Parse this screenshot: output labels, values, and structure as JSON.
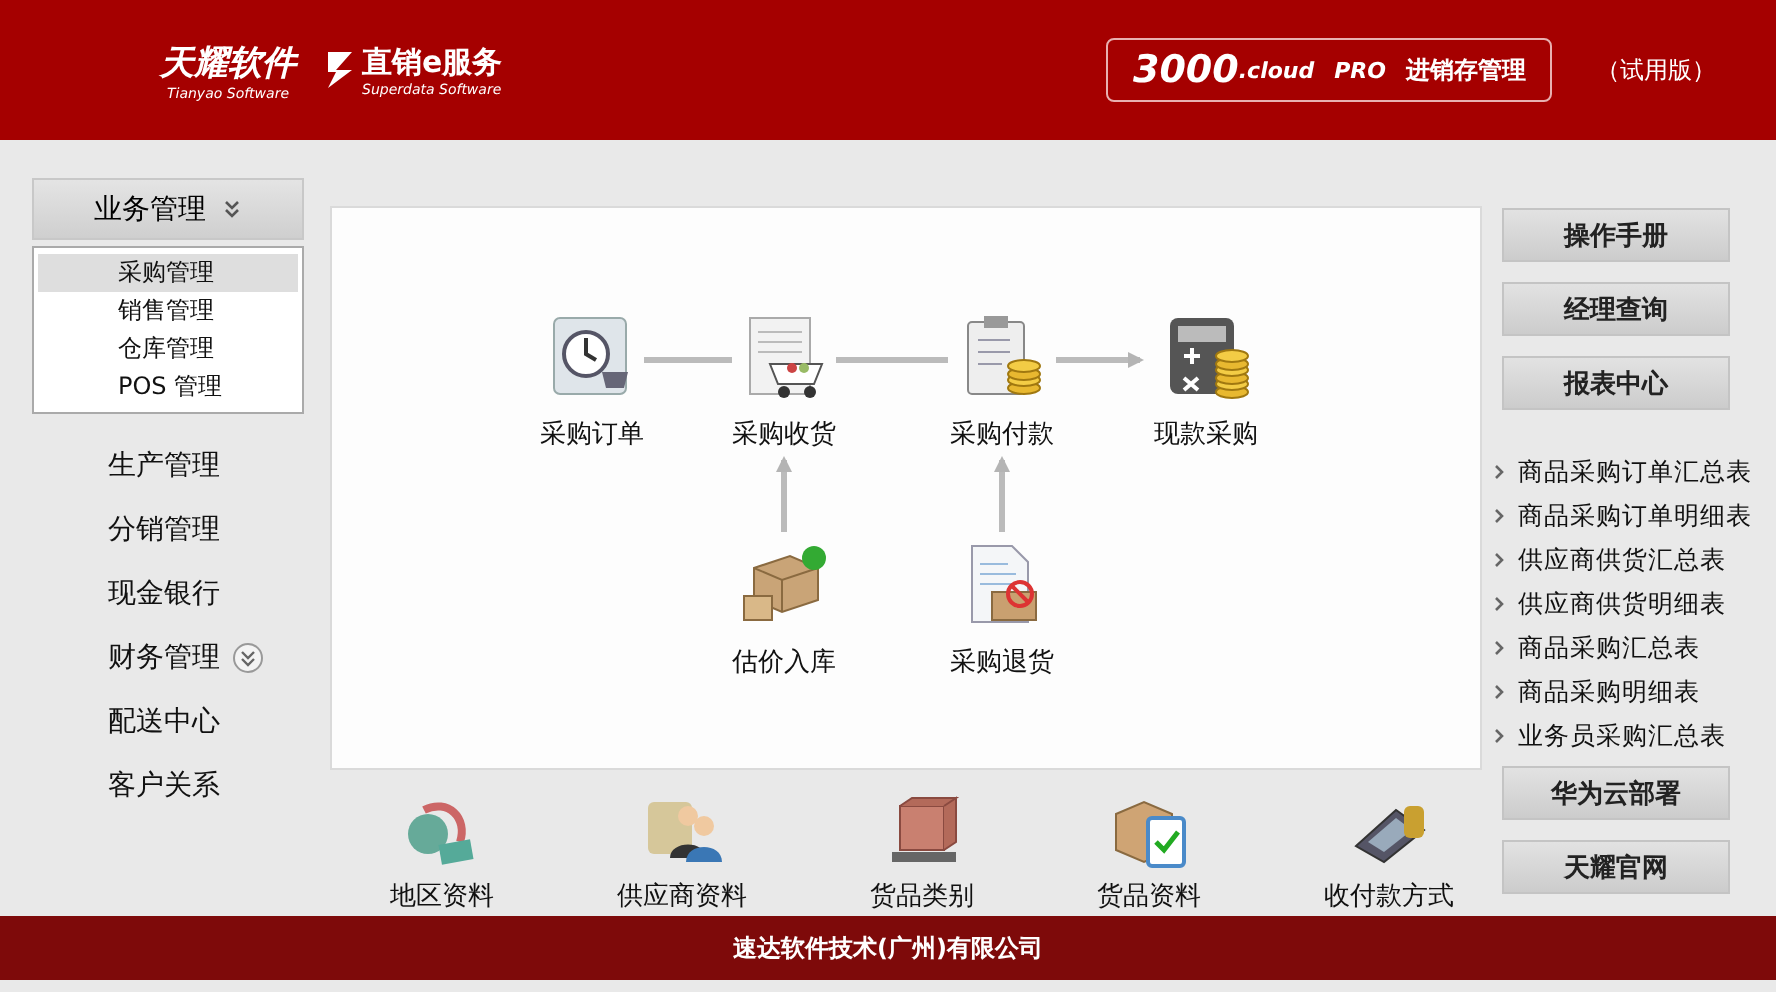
{
  "header": {
    "logo_main": "天耀软件",
    "logo_main_sub": "Tianyao Software",
    "logo_second": "直销e服务",
    "logo_second_sub": "Superdata Software",
    "product": {
      "number": "3000",
      "suffix": ".cloud",
      "edition": "PRO",
      "name": "进销存管理"
    },
    "trial": "（试用版）"
  },
  "sidebar": {
    "group": {
      "label": "业务管理",
      "expanded": true,
      "items": [
        {
          "label": "采购管理",
          "selected": true
        },
        {
          "label": "销售管理",
          "selected": false
        },
        {
          "label": "仓库管理",
          "selected": false
        },
        {
          "label": "POS 管理",
          "selected": false
        }
      ]
    },
    "items": [
      {
        "label": "生产管理",
        "collapsible": false
      },
      {
        "label": "分销管理",
        "collapsible": false
      },
      {
        "label": "现金银行",
        "collapsible": false
      },
      {
        "label": "财务管理",
        "collapsible": true
      },
      {
        "label": "配送中心",
        "collapsible": false
      },
      {
        "label": "客户关系",
        "collapsible": false
      }
    ]
  },
  "flow": {
    "top": [
      "采购订单",
      "采购收货",
      "采购付款",
      "现款采购"
    ],
    "bottom": [
      "估价入库",
      "采购退货"
    ]
  },
  "toolbar": [
    "地区资料",
    "供应商资料",
    "货品类别",
    "货品资料",
    "收付款方式"
  ],
  "right_panel": {
    "buttons_top": [
      "操作手册",
      "经理查询"
    ],
    "report_header": "报表中心",
    "reports": [
      "商品采购订单汇总表",
      "商品采购订单明细表",
      "供应商供货汇总表",
      "供应商供货明细表",
      "商品采购汇总表",
      "商品采购明细表",
      "业务员采购汇总表"
    ],
    "buttons_bottom": [
      "华为云部署",
      "天耀官网"
    ]
  },
  "footer": "速达软件技术(广州)有限公司"
}
